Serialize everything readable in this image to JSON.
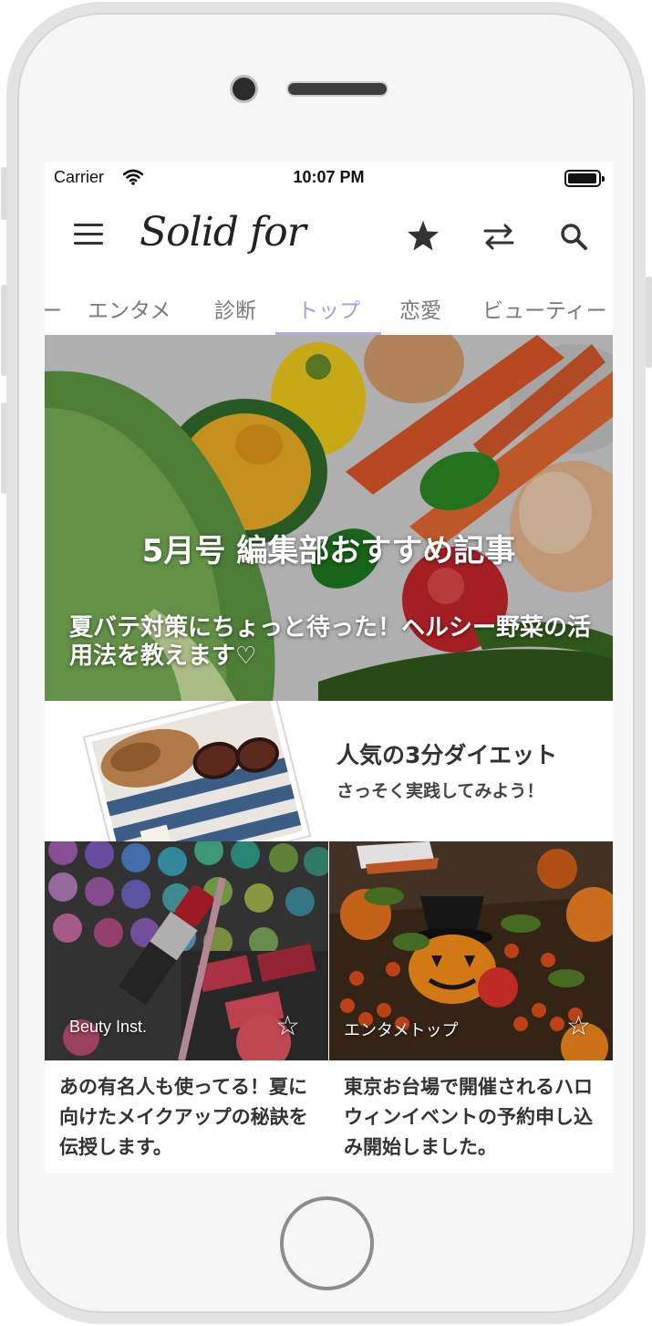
{
  "status_bar": {
    "carrier": "Carrier",
    "time": "10:07 PM"
  },
  "header": {
    "logo": "Solid for"
  },
  "tabs": [
    "ー",
    "エンタメ",
    "診断",
    "トップ",
    "恋愛",
    "ビューティー"
  ],
  "active_tab": "トップ",
  "hero": {
    "title": "5月号 編集部おすすめ記事",
    "subtitle": "夏バテ対策にちょっと待った！ヘルシー野菜の活用法を教えます♡"
  },
  "feature": {
    "title": "人気の3分ダイエット",
    "subtitle": "さっそく実践してみよう！"
  },
  "cards": [
    {
      "tag": "Beuty Inst.",
      "star": "☆",
      "text": "あの有名人も使ってる！夏に向けたメイクアップの秘訣を伝授します。"
    },
    {
      "tag": "エンタメトップ",
      "star": "☆",
      "text": "東京お台場で開催されるハロウィンイベントの予約申し込み開始しました。"
    }
  ],
  "icons": [
    "menu-icon",
    "star-icon",
    "swap-icon",
    "search-icon",
    "wifi-icon",
    "battery-icon"
  ],
  "colors": {
    "accent": "#a79fe6",
    "text": "#333333"
  }
}
